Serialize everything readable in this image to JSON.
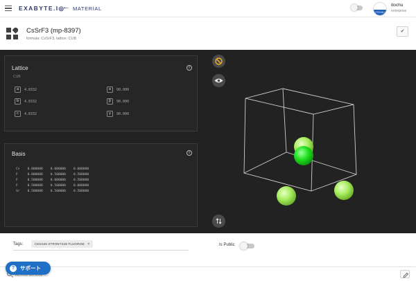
{
  "topbar": {
    "brand": "EXABYTE.I◎",
    "section": "MATERIAL",
    "user_name": "itochu",
    "user_org": "enterprise",
    "avatar_text": "ITOCHU"
  },
  "header": {
    "title": "CsSrF3 (mp-8397)",
    "subtitle": "formula: CsSrF3, lattice: CUB"
  },
  "lattice": {
    "title": "Lattice",
    "type": "CUB",
    "params": [
      {
        "label": "a",
        "value": "4.8332"
      },
      {
        "label": "b",
        "value": "4.8332"
      },
      {
        "label": "c",
        "value": "4.8332"
      },
      {
        "label": "α",
        "value": "90.000"
      },
      {
        "label": "β",
        "value": "90.000"
      },
      {
        "label": "γ",
        "value": "90.000"
      }
    ]
  },
  "basis": {
    "title": "Basis",
    "rows": [
      "Cs    0.000000    0.000000    0.000000",
      "F     0.000000    0.500000    0.500000",
      "F     0.500000    0.000000    0.500000",
      "F     0.500000    0.500000    0.000000",
      "Sr    0.500000    0.500000    0.500000"
    ]
  },
  "viewer": {
    "tools": [
      "forbid-icon",
      "eye-icon",
      "swap-vertical-icon"
    ],
    "colors": {
      "fluorine": "#a6ec5e",
      "cesium": "#1ee01e",
      "strontium": "#6a13b4",
      "cell_lines": "#cfcfcf"
    }
  },
  "bottom": {
    "tags_label": "Tags:",
    "tags": [
      "CESIUM STRONTIUM FLUORIDE"
    ],
    "public_label": "Is Public",
    "search_placeholder": "items below ...",
    "support_label": "サポート"
  }
}
